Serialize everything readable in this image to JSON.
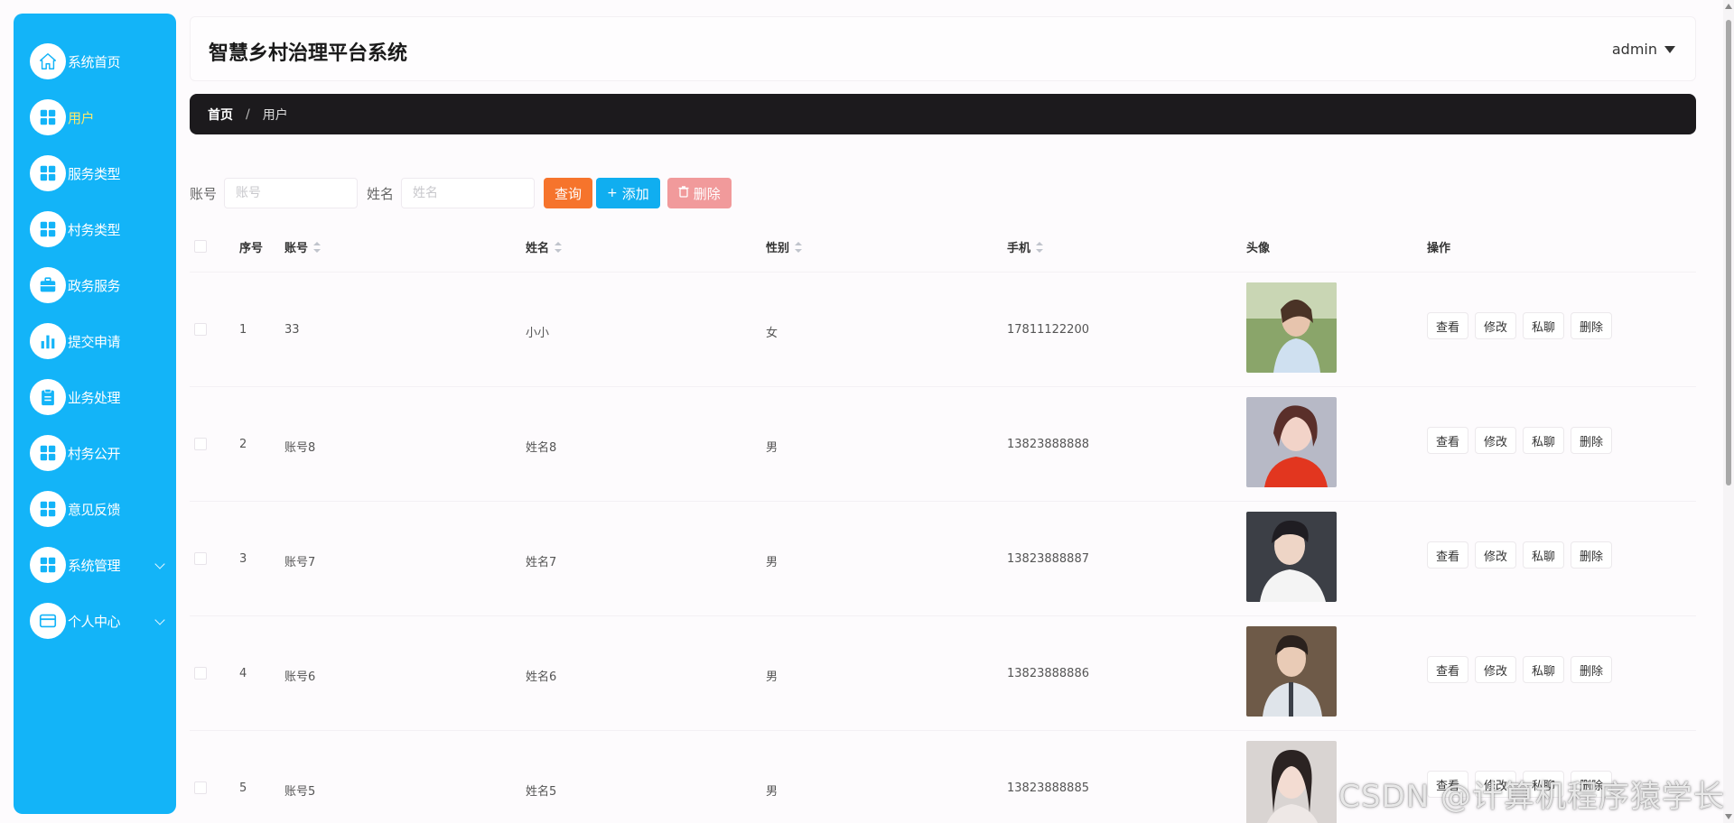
{
  "app": {
    "title": "智慧乡村治理平台系统",
    "user": "admin"
  },
  "colors": {
    "sidebar": "#13b4f8",
    "active_nav_text": "#fde96b",
    "query_button": "#f6742c",
    "add_button": "#10aef0",
    "delete_button": "#f19a9b",
    "breadcrumb_bg": "#1c1a1d"
  },
  "sidebar": {
    "items": [
      {
        "label": "系统首页",
        "icon": "home-icon"
      },
      {
        "label": "用户",
        "icon": "grid-icon",
        "active": true
      },
      {
        "label": "服务类型",
        "icon": "grid-icon"
      },
      {
        "label": "村务类型",
        "icon": "grid-icon"
      },
      {
        "label": "政务服务",
        "icon": "briefcase-icon"
      },
      {
        "label": "提交申请",
        "icon": "bar-chart-icon"
      },
      {
        "label": "业务处理",
        "icon": "clipboard-icon"
      },
      {
        "label": "村务公开",
        "icon": "grid-icon"
      },
      {
        "label": "意见反馈",
        "icon": "grid-icon"
      },
      {
        "label": "系统管理",
        "icon": "grid-icon",
        "expandable": true
      },
      {
        "label": "个人中心",
        "icon": "card-icon",
        "expandable": true
      }
    ]
  },
  "breadcrumb": {
    "home": "首页",
    "separator": "/",
    "current": "用户"
  },
  "search": {
    "account_label": "账号",
    "account_placeholder": "账号",
    "name_label": "姓名",
    "name_placeholder": "姓名",
    "query_button": "查询",
    "add_button": "添加",
    "delete_button": "删除"
  },
  "table": {
    "columns": {
      "index": "序号",
      "account": "账号",
      "name": "姓名",
      "gender": "性别",
      "phone": "手机",
      "avatar": "头像",
      "actions": "操作"
    },
    "row_actions": {
      "view": "查看",
      "edit": "修改",
      "chat": "私聊",
      "delete": "删除"
    },
    "rows": [
      {
        "index": "1",
        "account": "33",
        "name": "小小",
        "gender": "女",
        "phone": "17811122200",
        "avatar": "avatar-photo"
      },
      {
        "index": "2",
        "account": "账号8",
        "name": "姓名8",
        "gender": "男",
        "phone": "13823888888",
        "avatar": "avatar-photo"
      },
      {
        "index": "3",
        "account": "账号7",
        "name": "姓名7",
        "gender": "男",
        "phone": "13823888887",
        "avatar": "avatar-photo"
      },
      {
        "index": "4",
        "account": "账号6",
        "name": "姓名6",
        "gender": "男",
        "phone": "13823888886",
        "avatar": "avatar-photo"
      },
      {
        "index": "5",
        "account": "账号5",
        "name": "姓名5",
        "gender": "男",
        "phone": "13823888885",
        "avatar": "avatar-photo"
      }
    ]
  },
  "watermark": "CSDN @计算机程序猿学长"
}
